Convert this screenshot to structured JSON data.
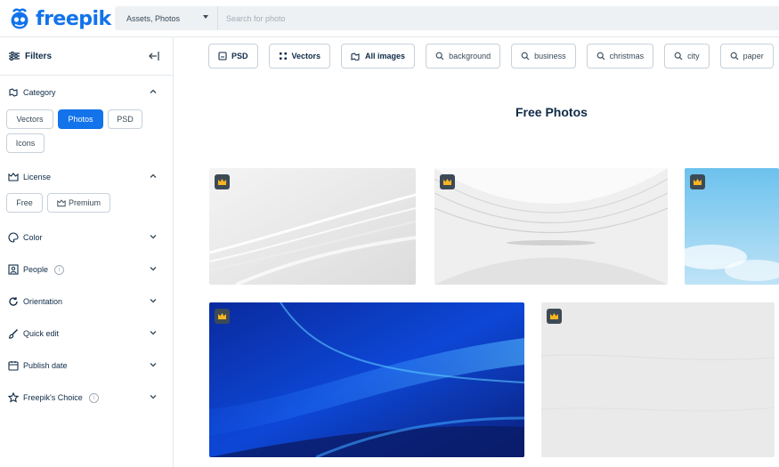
{
  "header": {
    "logo_text": "freepik",
    "asset_select": "Assets, Photos",
    "search_placeholder": "Search for photo"
  },
  "sidebar": {
    "filters_label": "Filters",
    "category": {
      "label": "Category",
      "options": [
        "Vectors",
        "Photos",
        "PSD",
        "Icons"
      ],
      "selected": "Photos"
    },
    "license": {
      "label": "License",
      "options": [
        "Free",
        "Premium"
      ]
    },
    "sections": [
      {
        "label": "Color",
        "icon": "palette-icon"
      },
      {
        "label": "People",
        "icon": "people-icon",
        "info": true
      },
      {
        "label": "Orientation",
        "icon": "orientation-icon"
      },
      {
        "label": "Quick edit",
        "icon": "brush-icon"
      },
      {
        "label": "Publish date",
        "icon": "calendar-icon"
      },
      {
        "label": "Freepik's Choice",
        "icon": "star-icon",
        "info": true
      }
    ],
    "info_glyph": "i"
  },
  "main": {
    "tags": [
      {
        "label": "PSD",
        "icon": "psd-icon"
      },
      {
        "label": "Vectors",
        "icon": "vectors-icon"
      },
      {
        "label": "All images",
        "icon": "images-icon"
      },
      {
        "label": "background",
        "icon": "search-icon"
      },
      {
        "label": "business",
        "icon": "search-icon"
      },
      {
        "label": "christmas",
        "icon": "search-icon"
      },
      {
        "label": "city",
        "icon": "search-icon"
      },
      {
        "label": "paper",
        "icon": "search-icon"
      }
    ],
    "title": "Free Photos"
  },
  "colors": {
    "brand_blue": "#1273eb",
    "text_dark": "#0e2a47",
    "crown_gold": "#f7b521"
  }
}
